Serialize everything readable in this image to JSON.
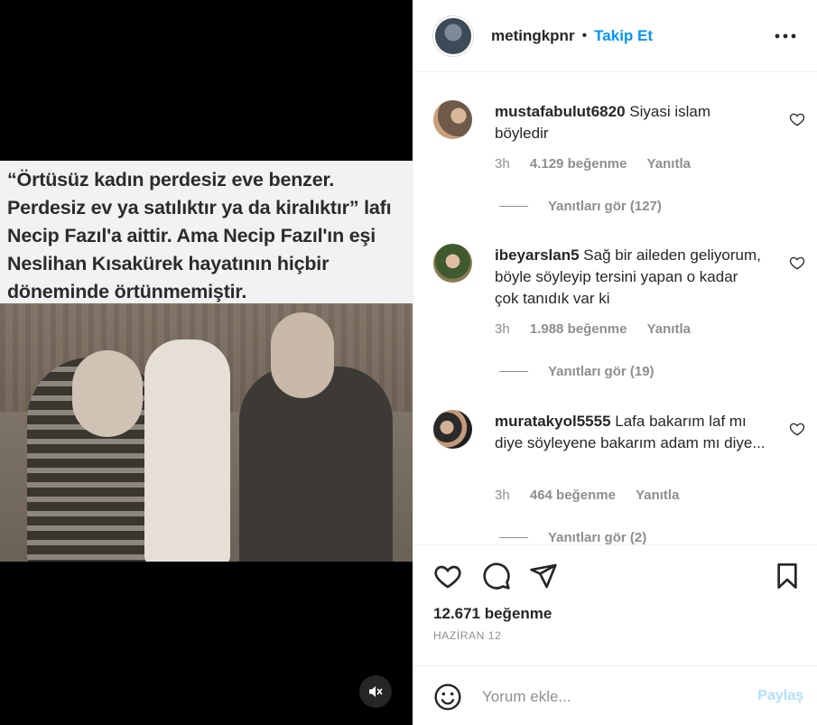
{
  "media": {
    "caption_lines": [
      "“Örtüsüz kadın perdesiz eve benzer.",
      "Perdesiz ev ya satılıktır ya da kiralıktır” lafı",
      "Necip Fazıl'a aittir. Ama  Necip Fazıl'ın eşi",
      "Neslihan Kısakürek hayatının hiçbir",
      "döneminde örtünmemiştir."
    ],
    "mute_icon": "speaker-muted-icon"
  },
  "header": {
    "username": "metingkpnr",
    "dot": "•",
    "follow_label": "Takip Et",
    "more_icon": "more-horizontal-icon"
  },
  "comments": [
    {
      "username": "mustafabulut6820",
      "text": "Siyasi islam böyledir",
      "time": "3h",
      "likes": "4.129 beğenme",
      "reply": "Yanıtla",
      "view_replies": "Yanıtları gör (127)"
    },
    {
      "username": "ibeyarslan5",
      "text": "Sağ bir aileden geliyorum, böyle söyleyip tersini yapan o kadar çok tanıdık var ki",
      "time": "3h",
      "likes": "1.988 beğenme",
      "reply": "Yanıtla",
      "view_replies": "Yanıtları gör (19)"
    },
    {
      "username": "muratakyol5555",
      "text": "Lafa bakarım laf mı diye söyleyene bakarım adam mı diye...",
      "time": "3h",
      "likes": "464 beğenme",
      "reply": "Yanıtla",
      "view_replies": "Yanıtları gör (2)"
    }
  ],
  "post": {
    "likes": "12.671 beğenme",
    "date": "HAZİRAN 12"
  },
  "composer": {
    "placeholder": "Yorum ekle...",
    "share_label": "Paylaş"
  },
  "colors": {
    "accent": "#0095f6",
    "share_disabled": "#b2dffc",
    "muted_text": "#8e8e8e",
    "primary_text": "#262626"
  }
}
